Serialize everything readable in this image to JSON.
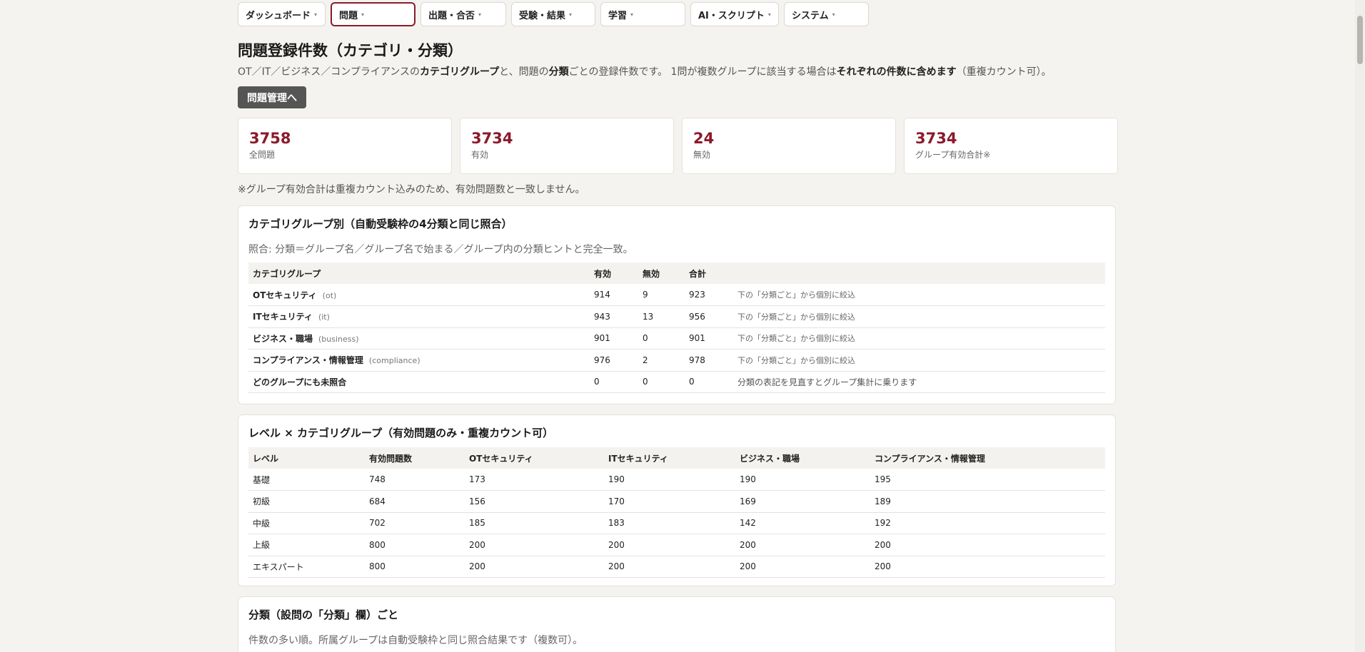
{
  "nav": [
    {
      "label": "ダッシュボード",
      "width": 123
    },
    {
      "label": "問題",
      "width": 119,
      "active": true
    },
    {
      "label": "出題・合否",
      "width": 120
    },
    {
      "label": "受験・結果",
      "width": 118
    },
    {
      "label": "学習",
      "width": 119
    },
    {
      "label": "AI・スクリプト",
      "width": 124
    },
    {
      "label": "システム",
      "width": 119
    }
  ],
  "caret": "▾",
  "page": {
    "title": "問題登録件数（カテゴリ・分類）",
    "desc": {
      "p1": "OT／IT／ビジネス／コンプライアンスの",
      "b1": "カテゴリグループ",
      "p2": "と、問題の",
      "b2": "分類",
      "p3": "ごとの登録件数です。 1問が複数グループに該当する場合は",
      "b3": "それぞれの件数に含めます",
      "p4": "（重複カウント可）。"
    },
    "manage_button": "問題管理へ",
    "note": "※グループ有効合計は重複カウント込みのため、有効問題数と一致しません。"
  },
  "stats": [
    {
      "value": "3758",
      "label": "全問題"
    },
    {
      "value": "3734",
      "label": "有効"
    },
    {
      "value": "24",
      "label": "無効"
    },
    {
      "value": "3734",
      "label": "グループ有効合計※"
    }
  ],
  "group_card": {
    "title": "カテゴリグループ別（自動受験枠の4分類と同じ照合）",
    "sub": "照合: 分類＝グループ名／グループ名で始まる／グループ内の分類ヒントと完全一致。",
    "headers": [
      "カテゴリグループ",
      "有効",
      "無効",
      "合計",
      ""
    ],
    "rows": [
      {
        "name": "OTセキュリティ",
        "code": "(ot)",
        "active": "914",
        "inactive": "9",
        "total": "923",
        "note": "下の「分類ごと」から個別に絞込"
      },
      {
        "name": "ITセキュリティ",
        "code": "(it)",
        "active": "943",
        "inactive": "13",
        "total": "956",
        "note": "下の「分類ごと」から個別に絞込"
      },
      {
        "name": "ビジネス・職場",
        "code": "(business)",
        "active": "901",
        "inactive": "0",
        "total": "901",
        "note": "下の「分類ごと」から個別に絞込"
      },
      {
        "name": "コンプライアンス・情報管理",
        "code": "(compliance)",
        "active": "976",
        "inactive": "2",
        "total": "978",
        "note": "下の「分類ごと」から個別に絞込"
      },
      {
        "name": "どのグループにも未照合",
        "code": "",
        "active": "0",
        "inactive": "0",
        "total": "0",
        "note": "分類の表記を見直すとグループ集計に乗ります"
      }
    ]
  },
  "level_card": {
    "title": "レベル × カテゴリグループ（有効問題のみ・重複カウント可）",
    "headers": [
      "レベル",
      "有効問題数",
      "OTセキュリティ",
      "ITセキュリティ",
      "ビジネス・職場",
      "コンプライアンス・情報管理"
    ],
    "rows": [
      [
        "基礎",
        "748",
        "173",
        "190",
        "190",
        "195"
      ],
      [
        "初級",
        "684",
        "156",
        "170",
        "169",
        "189"
      ],
      [
        "中級",
        "702",
        "185",
        "183",
        "142",
        "192"
      ],
      [
        "上級",
        "800",
        "200",
        "200",
        "200",
        "200"
      ],
      [
        "エキスパート",
        "800",
        "200",
        "200",
        "200",
        "200"
      ]
    ]
  },
  "category_card": {
    "title": "分類（設問の「分類」欄）ごと",
    "sub": "件数の多い順。所属グループは自動受験枠と同じ照合結果です（複数可）。"
  },
  "colors": {
    "accent": "#8b1a2b",
    "background": "#f5f3ef",
    "button_dark": "#555555"
  }
}
